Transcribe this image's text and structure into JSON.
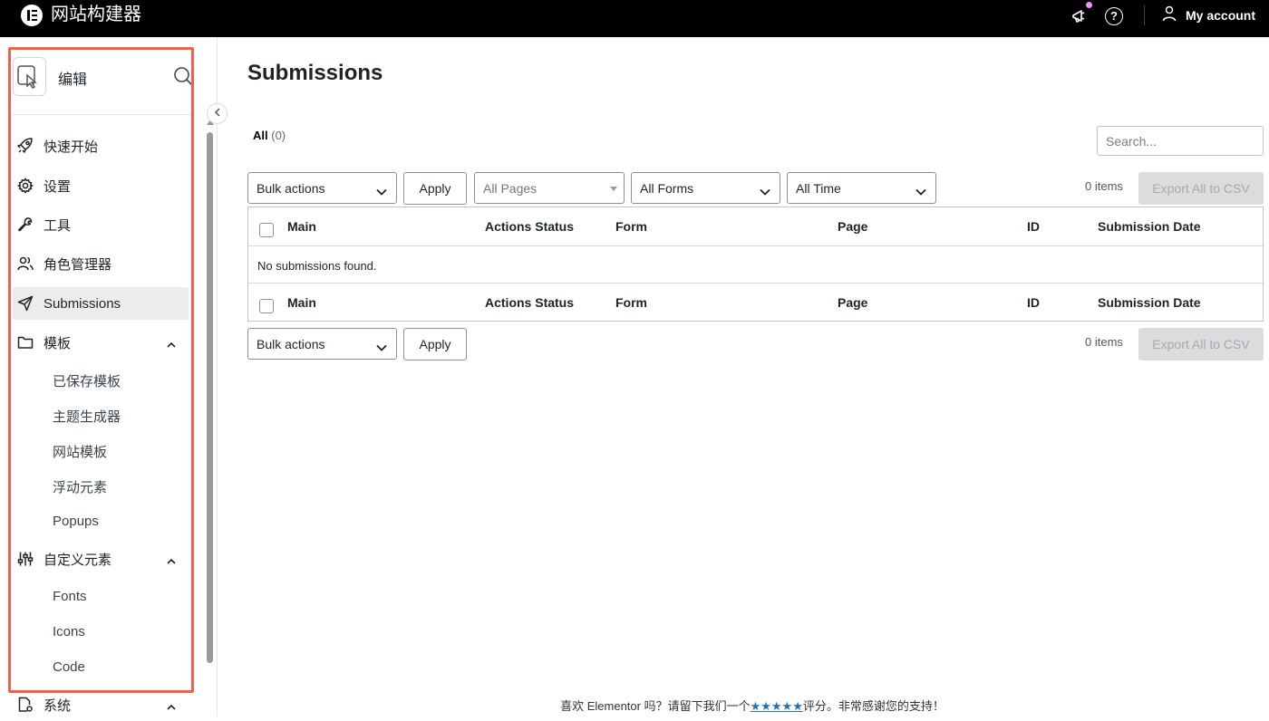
{
  "topbar": {
    "app_title": "网站构建器",
    "account_label": "My account",
    "icons": [
      "elementor-logo-icon",
      "megaphone-icon",
      "help-icon",
      "user-icon"
    ]
  },
  "sidebar": {
    "edit_label": "编辑",
    "items": [
      {
        "label": "快速开始",
        "icon": "rocket-icon"
      },
      {
        "label": "设置",
        "icon": "gear-icon"
      },
      {
        "label": "工具",
        "icon": "wrench-icon"
      },
      {
        "label": "角色管理器",
        "icon": "users-icon"
      },
      {
        "label": "Submissions",
        "icon": "send-icon",
        "active": true
      },
      {
        "label": "模板",
        "icon": "folder-icon",
        "expanded": true
      },
      {
        "label": "自定义元素",
        "icon": "sliders-icon",
        "expanded": true
      },
      {
        "label": "系统",
        "icon": "system-icon",
        "expanded": true
      }
    ],
    "templates_sub": [
      "已保存模板",
      "主题生成器",
      "网站模板",
      "浮动元素",
      "Popups"
    ],
    "custom_sub": [
      "Fonts",
      "Icons",
      "Code"
    ]
  },
  "main": {
    "title": "Submissions",
    "filter_all_label": "All",
    "filter_all_count": "(0)",
    "search_placeholder": "Search...",
    "bulk_actions": "Bulk actions",
    "apply": "Apply",
    "pages_select": "All Pages",
    "forms_select": "All Forms",
    "time_select": "All Time",
    "items_count": "0 items",
    "export_label": "Export All to CSV",
    "columns": [
      "Main",
      "Actions Status",
      "Form",
      "Page",
      "ID",
      "Submission Date"
    ],
    "empty_message": "No submissions found."
  },
  "footer": {
    "text_before": "喜欢 Elementor 吗？请留下我们一个",
    "stars": "★★★★★",
    "text_after": "评分。非常感谢您的支持！"
  },
  "colors": {
    "topbar": "#000000",
    "highlight_box": "#f0614c",
    "notification_dot": "#e996f4",
    "link": "#2271b1"
  }
}
